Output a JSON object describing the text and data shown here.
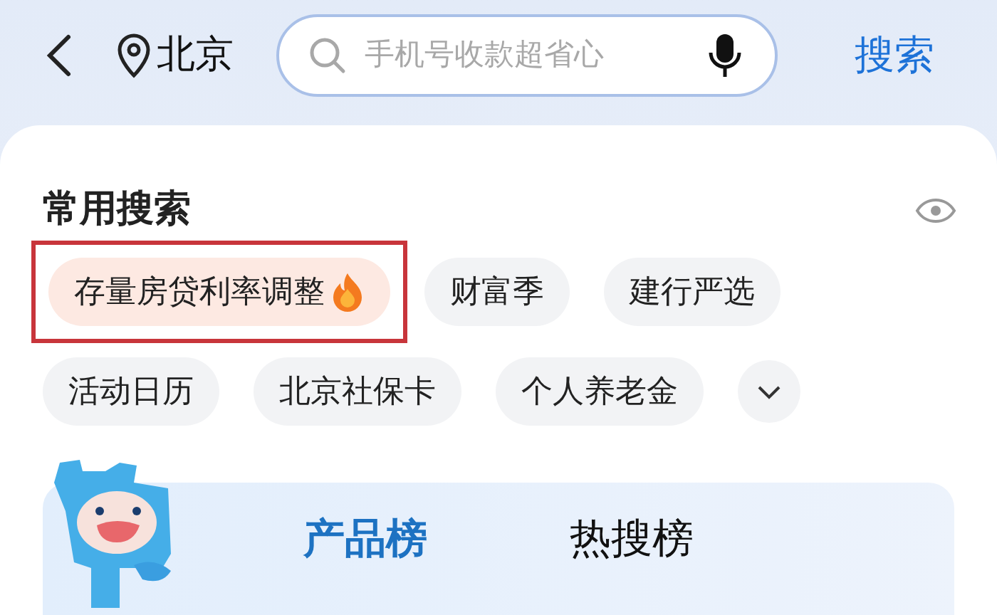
{
  "header": {
    "location": "北京",
    "search": {
      "placeholder": "手机号收款超省心"
    },
    "search_button": "搜索"
  },
  "recent_searches": {
    "title": "常用搜索",
    "chips": [
      {
        "label": "存量房贷利率调整",
        "hot": true,
        "highlighted": true
      },
      {
        "label": "财富季",
        "hot": false,
        "highlighted": false
      },
      {
        "label": "建行严选",
        "hot": false,
        "highlighted": false
      },
      {
        "label": "活动日历",
        "hot": false,
        "highlighted": false
      },
      {
        "label": "北京社保卡",
        "hot": false,
        "highlighted": false
      },
      {
        "label": "个人养老金",
        "hot": false,
        "highlighted": false
      }
    ],
    "expanded": false
  },
  "rank_tabs": [
    {
      "label": "产品榜",
      "selected": true
    },
    {
      "label": "热搜榜",
      "selected": false
    }
  ]
}
